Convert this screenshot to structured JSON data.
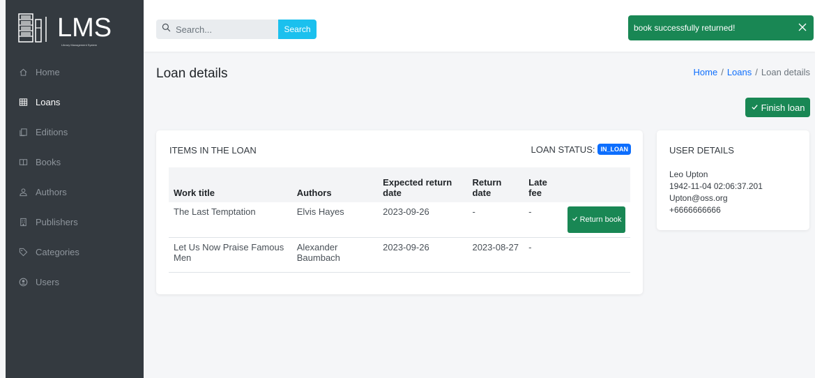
{
  "app": {
    "logo_text": "LMS",
    "logo_subtitle": "Library Management System"
  },
  "sidebar": {
    "items": [
      {
        "label": "Home",
        "icon": "home-icon",
        "active": false
      },
      {
        "label": "Loans",
        "icon": "table-icon",
        "active": true
      },
      {
        "label": "Editions",
        "icon": "copy-icon",
        "active": false
      },
      {
        "label": "Books",
        "icon": "book-open-icon",
        "active": false
      },
      {
        "label": "Authors",
        "icon": "person-icon",
        "active": false
      },
      {
        "label": "Publishers",
        "icon": "building-icon",
        "active": false
      },
      {
        "label": "Categories",
        "icon": "tag-icon",
        "active": false
      },
      {
        "label": "Users",
        "icon": "user-circle-icon",
        "active": false
      }
    ]
  },
  "search": {
    "placeholder": "Search...",
    "button": "Search"
  },
  "toast": {
    "message": "book successfully returned!"
  },
  "page": {
    "title": "Loan details",
    "breadcrumb": {
      "home": "Home",
      "sep": "/",
      "loans": "Loans",
      "current": "Loan details"
    },
    "finish_button": "Finish loan"
  },
  "loan": {
    "header": "ITEMS IN THE LOAN",
    "status_label": "LOAN STATUS:",
    "status_value": "IN_LOAN",
    "columns": [
      "Work title",
      "Authors",
      "Expected return date",
      "Return date",
      "Late fee"
    ],
    "rows": [
      {
        "title": "The Last Temptation",
        "authors": "Elvis Hayes",
        "expected": "2023-09-26",
        "returned": "-",
        "late_fee": "-",
        "action": "Return book"
      },
      {
        "title": "Let Us Now Praise Famous Men",
        "authors": "Alexander Baumbach",
        "expected": "2023-09-26",
        "returned": "2023-08-27",
        "late_fee": "-",
        "action": ""
      }
    ]
  },
  "user": {
    "header": "USER DETAILS",
    "name": "Leo Upton",
    "birth": "1942-11-04 02:06:37.201",
    "email": "Upton@oss.org",
    "phone": "+6666666666"
  },
  "colors": {
    "sidebar": "#343a40",
    "success": "#198754",
    "search_button": "#1bc0ee",
    "primary": "#0d6efd"
  }
}
